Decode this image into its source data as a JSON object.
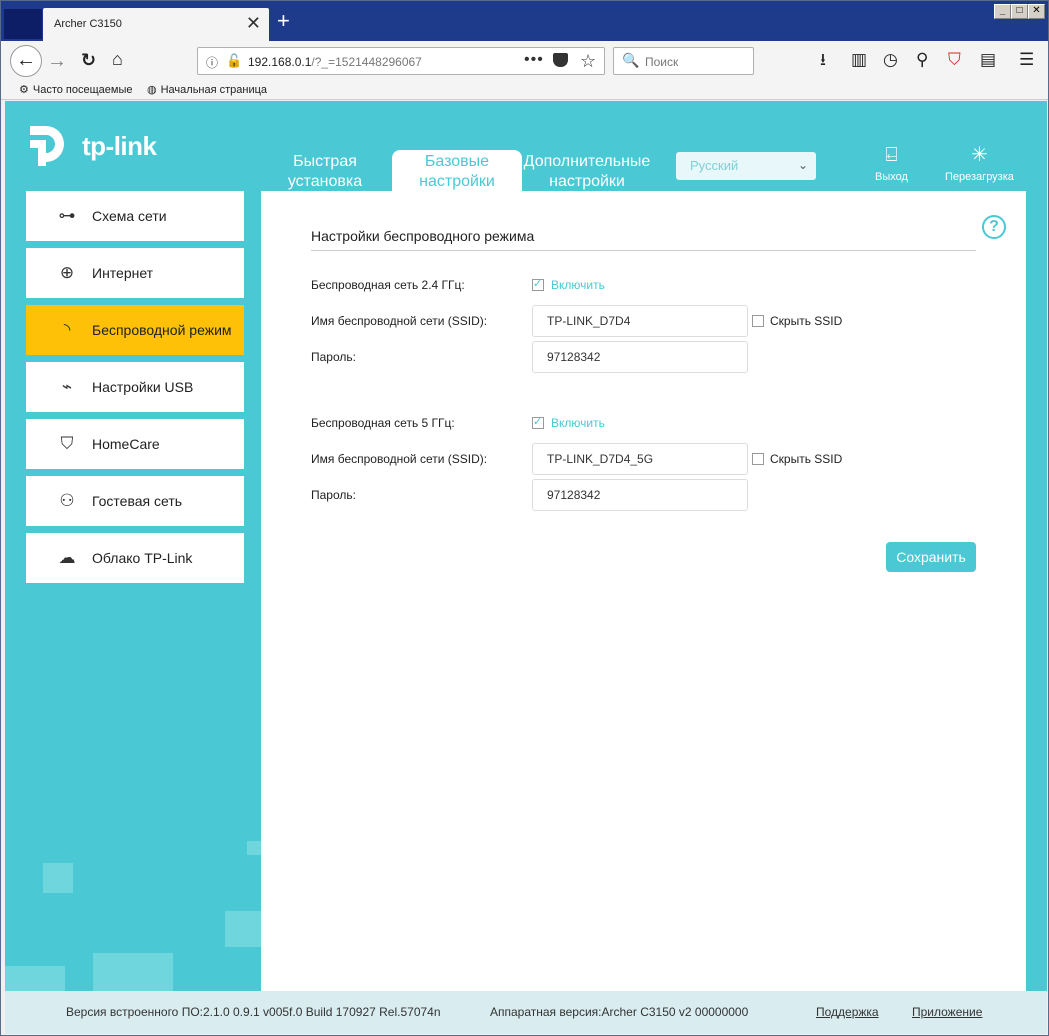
{
  "browser": {
    "tab_title": "Archer C3150",
    "tab_close": "✕",
    "new_tab": "+",
    "url_host": "192.168.0.1",
    "url_rest": "/?_=1521448296067",
    "search_placeholder": "Поиск",
    "bookmarks": [
      {
        "label": "Часто посещаемые",
        "icon": "gear-icon"
      },
      {
        "label": "Начальная страница",
        "icon": "globe-icon"
      }
    ],
    "window_buttons": [
      "_",
      "□",
      "✕"
    ]
  },
  "router": {
    "brand": "tp-link",
    "top_nav": [
      {
        "label_line1": "Быстрая",
        "label_line2": "установка",
        "active": false
      },
      {
        "label_line1": "Базовые",
        "label_line2": "настройки",
        "active": true
      },
      {
        "label_line1": "Дополнительные",
        "label_line2": "настройки",
        "active": false
      }
    ],
    "language": "Русский",
    "logout_label": "Выход",
    "reboot_label": "Перезагрузка",
    "sidebar": [
      {
        "label": "Схема сети",
        "icon": "network-map-icon",
        "active": false
      },
      {
        "label": "Интернет",
        "icon": "globe-icon",
        "active": false
      },
      {
        "label": "Беспроводной режим",
        "icon": "wireless-icon",
        "active": true
      },
      {
        "label": "Настройки USB",
        "icon": "usb-icon",
        "active": false
      },
      {
        "label": "HomeCare",
        "icon": "shield-icon",
        "active": false
      },
      {
        "label": "Гостевая сеть",
        "icon": "guests-icon",
        "active": false
      },
      {
        "label": "Облако TP-Link",
        "icon": "cloud-icon",
        "active": false
      }
    ],
    "content": {
      "title": "Настройки беспроводного режима",
      "band24": {
        "label": "Беспроводная сеть 2.4 ГГц:",
        "enable_label": "Включить",
        "enabled": true,
        "ssid_label": "Имя беспроводной сети (SSID):",
        "ssid": "TP-LINK_D7D4",
        "hide_label": "Скрыть SSID",
        "password_label": "Пароль:",
        "password": "97128342"
      },
      "band5": {
        "label": "Беспроводная сеть 5 ГГц:",
        "enable_label": "Включить",
        "enabled": true,
        "ssid_label": "Имя беспроводной сети (SSID):",
        "ssid": "TP-LINK_D7D4_5G",
        "hide_label": "Скрыть SSID",
        "password_label": "Пароль:",
        "password": "97128342"
      },
      "save_label": "Сохранить"
    },
    "footer": {
      "firmware": "Версия встроенного ПО:2.1.0 0.9.1 v005f.0 Build 170927 Rel.57074n",
      "hardware": "Аппаратная версия:Archer C3150 v2 00000000",
      "support": "Поддержка",
      "app": "Приложение"
    },
    "colors": {
      "accent": "#4ac8d4",
      "active_item": "#ffc107"
    }
  }
}
